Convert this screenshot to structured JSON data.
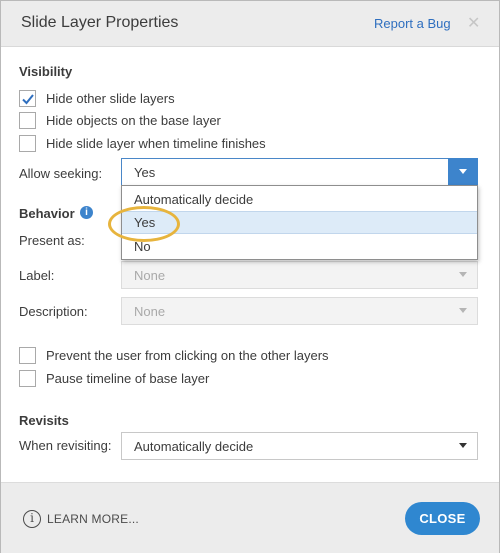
{
  "dialog": {
    "title": "Slide Layer Properties",
    "report_bug": "Report a Bug",
    "close_glyph": "✕"
  },
  "visibility": {
    "title": "Visibility",
    "options": [
      {
        "label": "Hide other slide layers",
        "checked": true
      },
      {
        "label": "Hide objects on the base layer",
        "checked": false
      },
      {
        "label": "Hide slide layer when timeline finishes",
        "checked": false
      }
    ],
    "allow_seeking": {
      "label": "Allow seeking:",
      "value": "Yes",
      "options": [
        "Automatically decide",
        "Yes",
        "No"
      ],
      "highlighted": "Yes"
    }
  },
  "behavior": {
    "title": "Behavior",
    "present_as": {
      "label": "Present as:"
    },
    "label_field": {
      "label": "Label:",
      "value": "None"
    },
    "description_field": {
      "label": "Description:",
      "value": "None"
    },
    "options": [
      {
        "label": "Prevent the user from clicking on the other layers",
        "checked": false
      },
      {
        "label": "Pause timeline of base layer",
        "checked": false
      }
    ]
  },
  "revisits": {
    "title": "Revisits",
    "when_revisiting": {
      "label": "When revisiting:",
      "value": "Automatically decide"
    }
  },
  "footer": {
    "learn_more": "LEARN MORE...",
    "close_button": "CLOSE"
  },
  "colors": {
    "accent": "#2f87d0",
    "highlight_ring": "#e7b43d",
    "link": "#2f6fbf"
  }
}
